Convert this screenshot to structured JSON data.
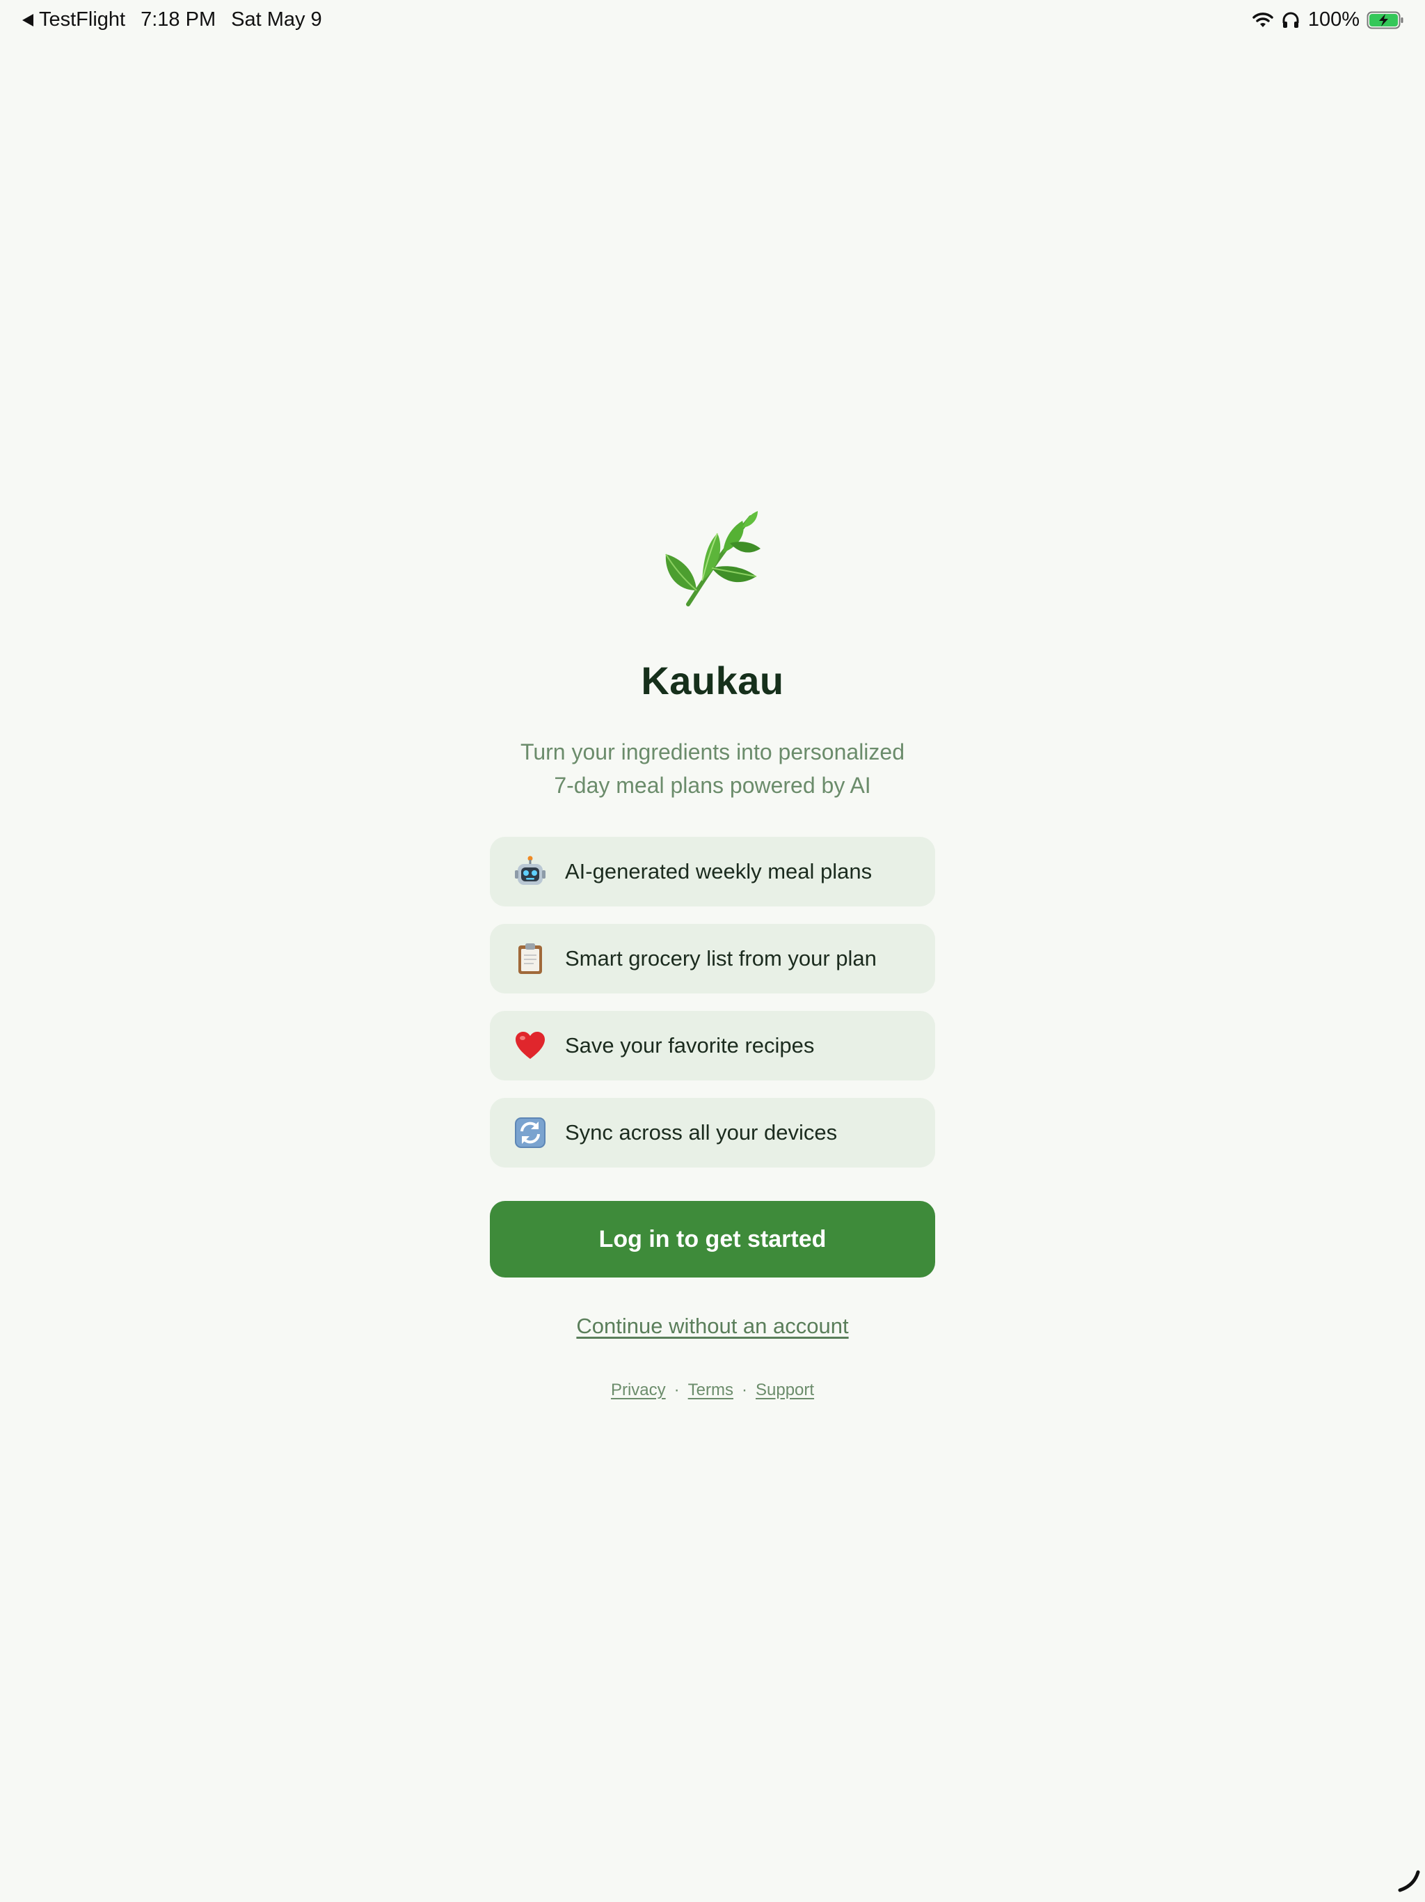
{
  "status_bar": {
    "back_app": "TestFlight",
    "time": "7:18 PM",
    "date": "Sat May 9",
    "battery_percent": "100%",
    "icons": [
      "back-arrow-icon",
      "wifi-icon",
      "headphones-icon",
      "battery-charging-icon"
    ]
  },
  "app": {
    "logo_icon": "herb-leaf-icon",
    "title": "Kaukau",
    "subtitle_line1": "Turn your ingredients into personalized",
    "subtitle_line2": "7-day meal plans powered by AI"
  },
  "features": [
    {
      "icon": "robot-icon",
      "label": "AI-generated weekly meal plans"
    },
    {
      "icon": "clipboard-icon",
      "label": "Smart grocery list from your plan"
    },
    {
      "icon": "heart-icon",
      "label": "Save your favorite recipes"
    },
    {
      "icon": "sync-icon",
      "label": "Sync across all your devices"
    }
  ],
  "actions": {
    "login_label": "Log in to get started",
    "continue_label": "Continue without an account"
  },
  "footer": {
    "privacy": "Privacy",
    "terms": "Terms",
    "support": "Support",
    "separator": "·"
  },
  "colors": {
    "background": "#f7f9f5",
    "primary_green": "#3e8b3a",
    "feature_bg": "#e8f0e6",
    "muted_green_text": "#6b8c6b",
    "title_text": "#16301b"
  }
}
